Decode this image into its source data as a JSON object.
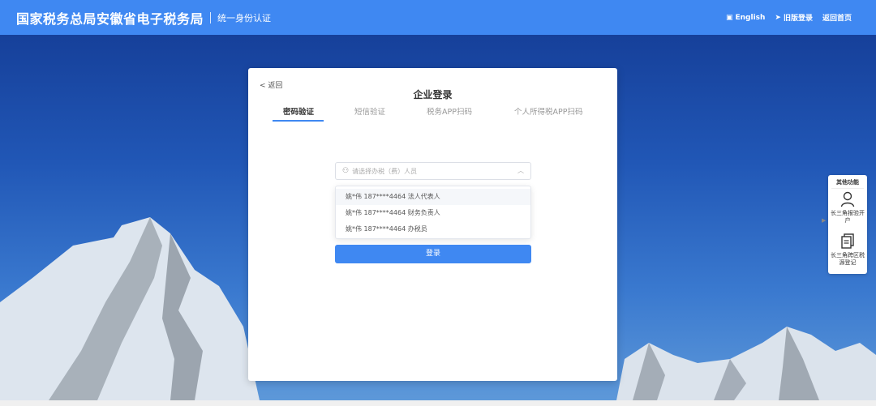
{
  "header": {
    "brand": "国家税务总局安徽省电子税务局",
    "subtitle": "统一身份认证",
    "english": "English",
    "old_login": "旧版登录",
    "home": "返回首页"
  },
  "card": {
    "back": "< 返回",
    "title": "企业登录",
    "tabs": [
      {
        "label": "密码验证"
      },
      {
        "label": "短信验证"
      },
      {
        "label": "税务APP扫码"
      },
      {
        "label": "个人所得税APP扫码"
      }
    ],
    "select_placeholder": "请选择办税（费）人员",
    "options": [
      {
        "label": "姚*伟 187****4464 法人代表人"
      },
      {
        "label": "姚*伟 187****4464 财务负责人"
      },
      {
        "label": "姚*伟 187****4464 办税员"
      }
    ],
    "login_label": "登录"
  },
  "side_panel": {
    "title": "其他功能",
    "items": [
      {
        "label": "长三角报验开户",
        "icon": "person-icon"
      },
      {
        "label": "长三角跨区税源登记",
        "icon": "document-icon"
      }
    ]
  },
  "colors": {
    "header": "#3f88f2",
    "accent": "#3f88f2"
  }
}
